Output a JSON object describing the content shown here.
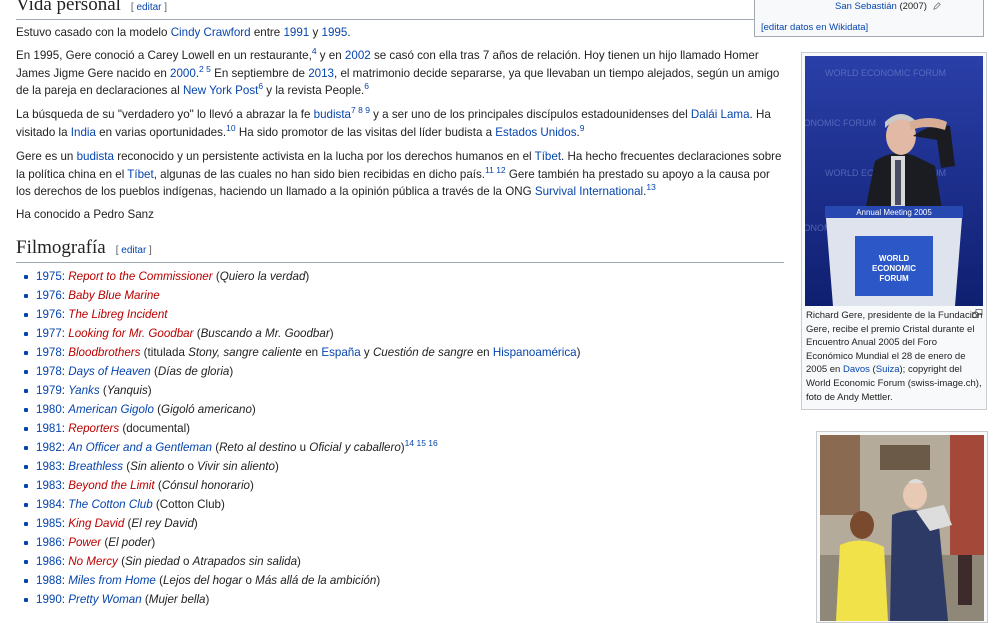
{
  "section_edit": "editar",
  "vida": {
    "heading": "Vida personal",
    "p1": {
      "a": "Estuvo casado con la modelo ",
      "link1": "Cindy Crawford",
      "b": " entre ",
      "link2": "1991",
      "c": " y ",
      "link3": "1995",
      "d": "."
    },
    "p2": {
      "a": "En 1995, Gere conoció a Carey Lowell en un restaurante,",
      "sup1": "4",
      "b": "  y en ",
      "link1": "2002",
      "c": " se casó con ella tras 7 años de relación. Hoy tienen un hijo llamado Homer James Jigme Gere nacido en ",
      "link2": "2000",
      "sup2": "2 5",
      "d": "  En septiembre de ",
      "link3": "2013",
      "e": ", el matrimonio decide separarse, ya que llevaban un tiempo alejados, según un amigo de la pareja en declaraciones al ",
      "link4": "New York Post",
      "sup3": "6",
      "f": "  y la revista People.",
      "sup4": "6"
    },
    "p3": {
      "a": "La búsqueda de su \"verdadero yo\" lo llevó a abrazar la fe ",
      "link1": "budista",
      "sup1": "7 8 9",
      "b": "  y a ser uno de los principales discípulos estadounidenses del ",
      "link2": "Dalái Lama",
      "c": ". Ha visitado la ",
      "link3": "India",
      "d": " en varias oportunidades.",
      "sup2": "10",
      "e": "  Ha sido promotor de las visitas del líder budista a ",
      "link4": "Estados Unidos",
      "f": ".",
      "sup3": "9"
    },
    "p4": {
      "a": "Gere es un ",
      "link1": "budista",
      "b": " reconocido y un persistente activista en la lucha por los derechos humanos en el ",
      "link2": "Tíbet",
      "c": ". Ha hecho frecuentes declaraciones sobre la política china en el ",
      "link3": "Tíbet",
      "d": ", algunas de las cuales no han sido bien recibidas en dicho país.",
      "sup1": "11 12",
      "e": "  Gere también ha prestado su apoyo a la causa por los derechos de los pueblos indígenas, haciendo un llamado a la opinión pública a través de la ONG ",
      "link4": "Survival International",
      "f": ".",
      "sup2": "13"
    },
    "p5": "Ha conocido a Pedro Sanz"
  },
  "filmografia": {
    "heading": "Filmografía",
    "items": [
      {
        "year": "1975",
        "title": "Report to the Commissioner",
        "red": true,
        "rest": [
          {
            "t": " ("
          },
          {
            "t": "Quiero la verdad",
            "i": true
          },
          {
            "t": ")"
          }
        ]
      },
      {
        "year": "1976",
        "title": "Baby Blue Marine",
        "red": true,
        "rest": []
      },
      {
        "year": "1976",
        "title": "The Libreg Incident",
        "red": true,
        "rest": []
      },
      {
        "year": "1977",
        "title": "Looking for Mr. Goodbar",
        "red": true,
        "rest": [
          {
            "t": " ("
          },
          {
            "t": "Buscando a Mr. Goodbar",
            "i": true
          },
          {
            "t": ")"
          }
        ]
      },
      {
        "year": "1978",
        "title": "Bloodbrothers",
        "red": true,
        "rest": [
          {
            "t": " (titulada "
          },
          {
            "t": "Stony, sangre caliente",
            "i": true
          },
          {
            "t": " en "
          },
          {
            "t": "España",
            "link": true
          },
          {
            "t": " y "
          },
          {
            "t": "Cuestión de sangre",
            "i": true
          },
          {
            "t": " en "
          },
          {
            "t": "Hispanoamérica",
            "link": true
          },
          {
            "t": ")"
          }
        ]
      },
      {
        "year": "1978",
        "title": "Days of Heaven",
        "red": false,
        "rest": [
          {
            "t": " ("
          },
          {
            "t": "Días de gloria",
            "i": true
          },
          {
            "t": ")"
          }
        ]
      },
      {
        "year": "1979",
        "title": "Yanks",
        "red": false,
        "rest": [
          {
            "t": " ("
          },
          {
            "t": "Yanquis",
            "i": true
          },
          {
            "t": ")"
          }
        ]
      },
      {
        "year": "1980",
        "title": "American Gigolo",
        "red": false,
        "rest": [
          {
            "t": " ("
          },
          {
            "t": "Gigoló americano",
            "i": true
          },
          {
            "t": ")"
          }
        ]
      },
      {
        "year": "1981",
        "title": "Reporters",
        "red": true,
        "rest": [
          {
            "t": " (documental)"
          }
        ]
      },
      {
        "year": "1982",
        "title": "An Officer and a Gentleman",
        "red": false,
        "rest": [
          {
            "t": " ("
          },
          {
            "t": "Reto al destino",
            "i": true
          },
          {
            "t": " u "
          },
          {
            "t": "Oficial y caballero",
            "i": true
          },
          {
            "t": ")"
          },
          {
            "t": "14 15 16",
            "sup": true
          }
        ]
      },
      {
        "year": "1983",
        "title": "Breathless",
        "red": false,
        "rest": [
          {
            "t": " ("
          },
          {
            "t": "Sin aliento",
            "i": true
          },
          {
            "t": " o "
          },
          {
            "t": "Vivir sin aliento",
            "i": true
          },
          {
            "t": ")"
          }
        ]
      },
      {
        "year": "1983",
        "title": "Beyond the Limit",
        "red": true,
        "rest": [
          {
            "t": " ("
          },
          {
            "t": "Cónsul honorario",
            "i": true
          },
          {
            "t": ")"
          }
        ]
      },
      {
        "year": "1984",
        "title": "The Cotton Club",
        "red": false,
        "rest": [
          {
            "t": " (Cotton Club)"
          }
        ]
      },
      {
        "year": "1985",
        "title": "King David",
        "red": true,
        "rest": [
          {
            "t": " ("
          },
          {
            "t": "El rey David",
            "i": true
          },
          {
            "t": ")"
          }
        ]
      },
      {
        "year": "1986",
        "title": "Power",
        "red": true,
        "rest": [
          {
            "t": " ("
          },
          {
            "t": "El poder",
            "i": true
          },
          {
            "t": ")"
          }
        ]
      },
      {
        "year": "1986",
        "title": "No Mercy",
        "red": true,
        "rest": [
          {
            "t": " ("
          },
          {
            "t": "Sin piedad",
            "i": true
          },
          {
            "t": " o "
          },
          {
            "t": "Atrapados sin salida",
            "i": true
          },
          {
            "t": ")"
          }
        ]
      },
      {
        "year": "1988",
        "title": "Miles from Home",
        "red": false,
        "rest": [
          {
            "t": " ("
          },
          {
            "t": "Lejos del hogar",
            "i": true
          },
          {
            "t": " o "
          },
          {
            "t": "Más allá de la ambición",
            "i": true
          },
          {
            "t": ")"
          }
        ]
      },
      {
        "year": "1990",
        "title": "Pretty Woman",
        "red": false,
        "rest": [
          {
            "t": " ("
          },
          {
            "t": "Mujer bella",
            "i": true
          },
          {
            "t": ")"
          }
        ]
      }
    ]
  },
  "sidebar": {
    "wikidata_place": "San Sebastián",
    "wikidata_year": "(2007)",
    "wikidata_edit": "[editar datos en Wikidata]",
    "photo_banner": "Annual Meeting 2005",
    "photo_backdrop": "WORLD ECONOMIC FORUM",
    "podium_logo": [
      "WORLD",
      "ECONOMIC",
      "FORUM"
    ],
    "caption": {
      "a": "Richard Gere, presidente de la Fundación Gere, recibe el premio Cristal durante el Encuentro Anual 2005 del Foro Económico Mundial el 28 de enero de 2005 en ",
      "link1": "Davos",
      "b": " (",
      "link2": "Suiza",
      "c": "); copyright del World Economic Forum (swiss-image.ch), foto de Andy Mettler."
    }
  },
  "colors": {
    "link": "#0645ad",
    "redlink": "#ba0000",
    "text": "#222222"
  }
}
